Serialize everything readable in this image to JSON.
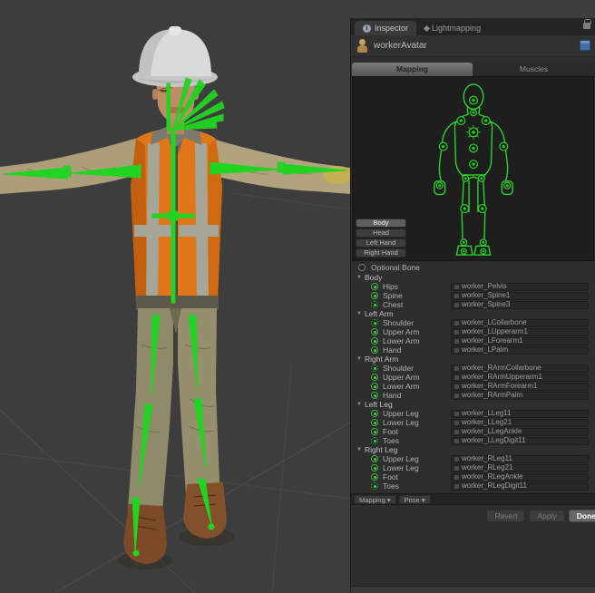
{
  "editor_tabs": {
    "inspector": "Inspector",
    "lightmapping": "Lightmapping"
  },
  "header": {
    "title": "workerAvatar"
  },
  "mode_tabs": {
    "mapping": "Mapping",
    "muscles": "Muscles"
  },
  "body_part_buttons": [
    {
      "label": "Body",
      "selected": true
    },
    {
      "label": "Head",
      "selected": false
    },
    {
      "label": "Left Hand",
      "selected": false
    },
    {
      "label": "Right Hand",
      "selected": false
    }
  ],
  "optional_bone_label": "Optional Bone",
  "bone_sections": [
    {
      "label": "Body",
      "rows": [
        {
          "label": "Hips",
          "value": "worker_Pelvis",
          "optional": false
        },
        {
          "label": "Spine",
          "value": "worker_Spine1",
          "optional": false
        },
        {
          "label": "Chest",
          "value": "worker_Spine3",
          "optional": true
        }
      ]
    },
    {
      "label": "Left Arm",
      "rows": [
        {
          "label": "Shoulder",
          "value": "worker_LCollarbone",
          "optional": true
        },
        {
          "label": "Upper Arm",
          "value": "worker_LUpperarm1",
          "optional": false
        },
        {
          "label": "Lower Arm",
          "value": "worker_LForearm1",
          "optional": false
        },
        {
          "label": "Hand",
          "value": "worker_LPalm",
          "optional": false
        }
      ]
    },
    {
      "label": "Right Arm",
      "rows": [
        {
          "label": "Shoulder",
          "value": "worker_RArmCollarbone",
          "optional": true
        },
        {
          "label": "Upper Arm",
          "value": "worker_RArmUpperarm1",
          "optional": false
        },
        {
          "label": "Lower Arm",
          "value": "worker_RArmForearm1",
          "optional": false
        },
        {
          "label": "Hand",
          "value": "worker_RArmPalm",
          "optional": false
        }
      ]
    },
    {
      "label": "Left Leg",
      "rows": [
        {
          "label": "Upper Leg",
          "value": "worker_LLeg11",
          "optional": false
        },
        {
          "label": "Lower Leg",
          "value": "worker_LLeg21",
          "optional": false
        },
        {
          "label": "Foot",
          "value": "worker_LLegAnkle",
          "optional": false
        },
        {
          "label": "Toes",
          "value": "worker_LLegDigit11",
          "optional": true
        }
      ]
    },
    {
      "label": "Right Leg",
      "rows": [
        {
          "label": "Upper Leg",
          "value": "worker_RLeg11",
          "optional": false
        },
        {
          "label": "Lower Leg",
          "value": "worker_RLeg21",
          "optional": false
        },
        {
          "label": "Foot",
          "value": "worker_RLegAnkle",
          "optional": false
        },
        {
          "label": "Toes",
          "value": "worker_RLegDigit11",
          "optional": true
        }
      ]
    }
  ],
  "footer": {
    "mapping_menu": "Mapping",
    "pose_menu": "Pose",
    "revert": "Revert",
    "apply": "Apply",
    "done": "Done"
  },
  "colors": {
    "bone_green": "#2bd42b",
    "vest_orange": "#e0761a",
    "scene_bg": "#3d3d3d",
    "diagram_bg": "#1e1e1e",
    "hardhat_white": "#d9d9d9"
  }
}
